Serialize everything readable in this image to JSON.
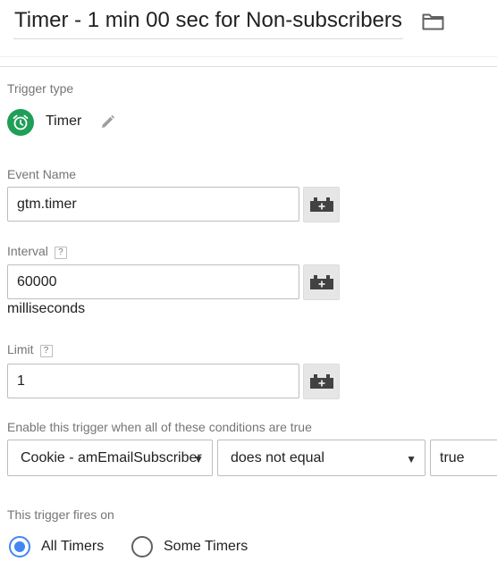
{
  "header": {
    "title": "Timer - 1 min 00 sec for Non-subscribers",
    "folder_icon": "folder-icon"
  },
  "trigger_type": {
    "label": "Trigger type",
    "name": "Timer",
    "icon": "alarm-clock-icon",
    "icon_color": "#1e9e57"
  },
  "event_name": {
    "label": "Event Name",
    "value": "gtm.timer"
  },
  "interval": {
    "label": "Interval",
    "help": "?",
    "value": "60000",
    "units": "milliseconds"
  },
  "limit": {
    "label": "Limit",
    "help": "?",
    "value": "1"
  },
  "conditions": {
    "label": "Enable this trigger when all of these conditions are true",
    "variable": "Cookie - amEmailSubscriber",
    "operator": "does not equal",
    "value": "true"
  },
  "fires_on": {
    "label": "This trigger fires on",
    "options": [
      {
        "label": "All Timers",
        "selected": true
      },
      {
        "label": "Some Timers",
        "selected": false
      }
    ]
  },
  "colors": {
    "accent": "#4285f4",
    "label": "#757575",
    "border": "#bdbdbd"
  }
}
